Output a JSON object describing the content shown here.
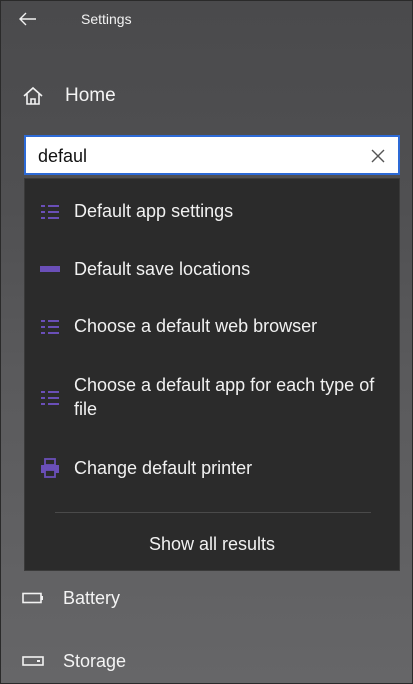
{
  "app": {
    "title": "Settings"
  },
  "nav": {
    "home_label": "Home"
  },
  "search": {
    "value": "defaul",
    "placeholder": ""
  },
  "suggestions": [
    {
      "icon": "list-icon",
      "label": "Default app settings"
    },
    {
      "icon": "drive-icon",
      "label": "Default save locations"
    },
    {
      "icon": "list-icon",
      "label": "Choose a default web browser"
    },
    {
      "icon": "list-icon",
      "label": "Choose a default app for each type of file"
    },
    {
      "icon": "printer-icon",
      "label": "Change default printer"
    }
  ],
  "show_all_label": "Show all results",
  "sidebar_items": [
    {
      "icon": "battery-icon",
      "label": "Battery"
    },
    {
      "icon": "storage-icon",
      "label": "Storage"
    }
  ],
  "colors": {
    "accent": "#2d6ad6",
    "icon_accent": "#6a4fb8",
    "flyout_bg": "#2b2b2b"
  }
}
